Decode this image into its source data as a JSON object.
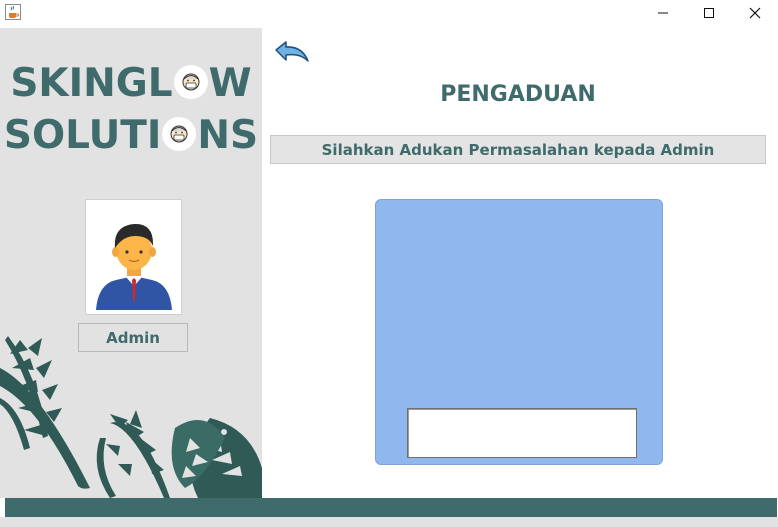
{
  "window": {
    "app_icon": "java-cup-icon",
    "controls": [
      "minimize-icon",
      "maximize-icon",
      "close-icon"
    ]
  },
  "sidebar": {
    "brand_line1_left": "SKINGL",
    "brand_line1_right": "W",
    "brand_line2_left": "SOLUTI",
    "brand_line2_right": "NS",
    "logo_icon": "face-mask-logo-icon",
    "avatar_icon": "businessman-avatar-icon",
    "role_label": "Admin",
    "decoration": "tropical-leaves"
  },
  "main": {
    "back_icon": "back-arrow-icon",
    "title": "PENGADUAN",
    "subtitle": "Silahkan Adukan Permasalahan kepada Admin",
    "complaint_input_value": ""
  },
  "colors": {
    "brand": "#3f6b6c",
    "panel": "#e2e2e2",
    "card": "#91b8ee"
  }
}
